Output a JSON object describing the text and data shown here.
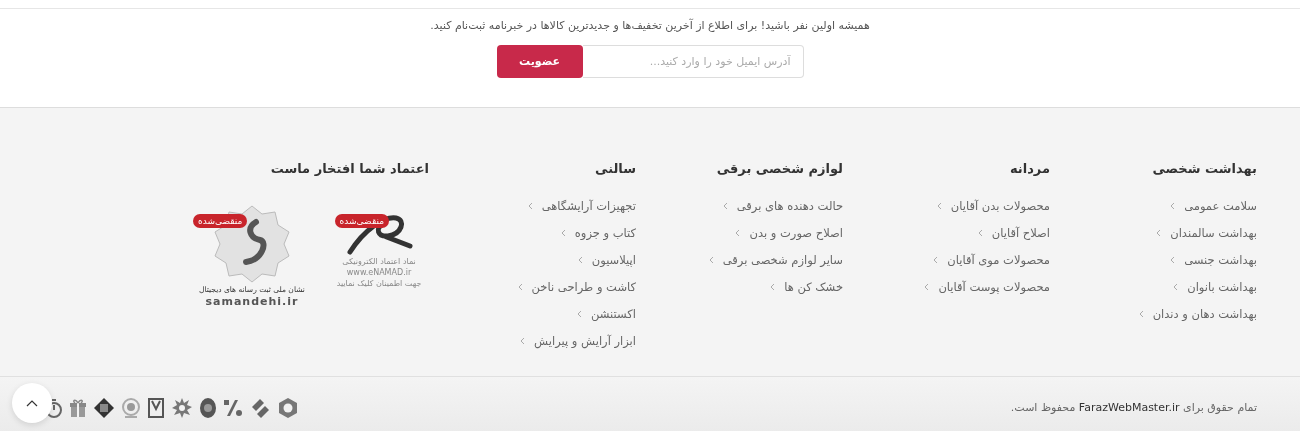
{
  "newsletter": {
    "text": "همیشه اولین نفر باشید! برای اطلاع از آخرین تخفیف‌ها و جدیدترین کالاها در خبرنامه ثبت‌نام کنید.",
    "placeholder": "آدرس ایمیل خود را وارد کنید...",
    "button": "عضویت"
  },
  "columns": [
    {
      "title": "بهداشت شخصی",
      "items": [
        "سلامت عمومی",
        "بهداشت سالمندان",
        "بهداشت جنسی",
        "بهداشت بانوان",
        "بهداشت دهان و دندان"
      ]
    },
    {
      "title": "مردانه",
      "items": [
        "محصولات بدن آقایان",
        "اصلاح آقایان",
        "محصولات موی آقایان",
        "محصولات پوست آقایان"
      ]
    },
    {
      "title": "لوازم شخصی برقی",
      "items": [
        "حالت دهنده های برقی",
        "اصلاح صورت و بدن",
        "سایر لوازم شخصی برقی",
        "خشک کن ها"
      ]
    },
    {
      "title": "سالنی",
      "items": [
        "تجهیزات آرایشگاهی",
        "کتاب و جزوه",
        "اپیلاسیون",
        "کاشت و طراحی ناخن",
        "اکستنشن",
        "ابزار آرایش و پیرایش"
      ]
    }
  ],
  "trust": {
    "title": "اعتماد شما افتخار ماست",
    "badges": [
      {
        "kind": "enamad",
        "status": "منقضی‌شده",
        "lines": [
          "نماد اعتماد الکترونیکی",
          "www.eNAMAD.ir",
          "جهت اطمینان کلیک نمایید"
        ]
      },
      {
        "kind": "samandehi",
        "status": "منقضی‌شده",
        "lines": [
          "نشان ملی ثبت رسانه های دیجیتال",
          "samandehi.ir"
        ]
      }
    ]
  },
  "copyright": {
    "before": "تمام حقوق برای",
    "link": "FarazWebMaster.ir",
    "after": "محفوظ است."
  }
}
